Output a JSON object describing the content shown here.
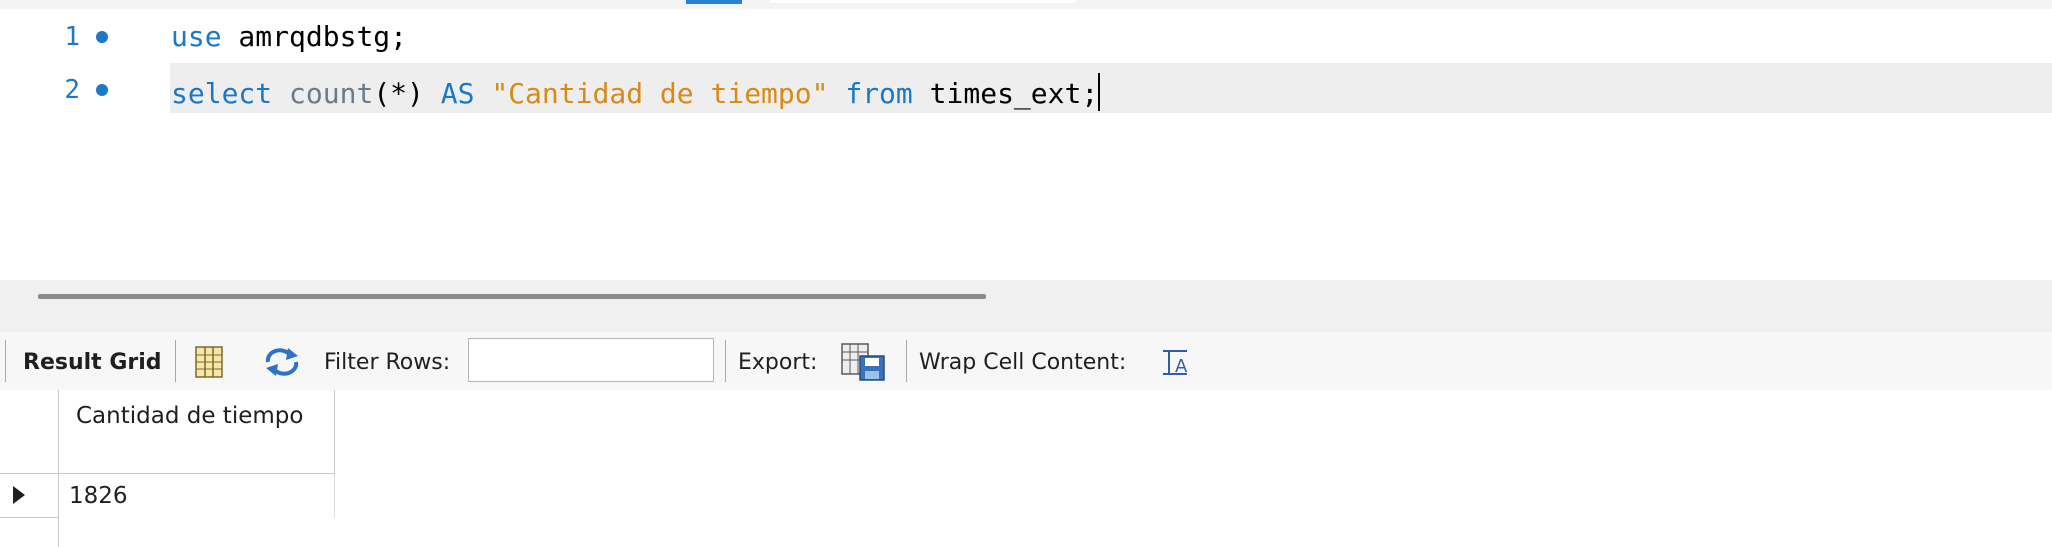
{
  "editor": {
    "lines": [
      {
        "number": "1",
        "tokens": [
          {
            "text": "use",
            "kind": "kw"
          },
          {
            "text": " amrqdbstg;",
            "kind": "plain"
          }
        ]
      },
      {
        "number": "2",
        "tokens": [
          {
            "text": "select",
            "kind": "kw"
          },
          {
            "text": " ",
            "kind": "plain"
          },
          {
            "text": "count",
            "kind": "fn"
          },
          {
            "text": "(*) ",
            "kind": "plain"
          },
          {
            "text": "AS",
            "kind": "kw"
          },
          {
            "text": " ",
            "kind": "plain"
          },
          {
            "text": "\"Cantidad de tiempo\"",
            "kind": "str"
          },
          {
            "text": " ",
            "kind": "plain"
          },
          {
            "text": "from",
            "kind": "kw"
          },
          {
            "text": " times_ext;",
            "kind": "plain"
          }
        ]
      }
    ]
  },
  "result_toolbar": {
    "result_grid_label": "Result Grid",
    "filter_rows_label": "Filter Rows:",
    "filter_value": "",
    "export_label": "Export:",
    "wrap_cell_label": "Wrap Cell Content:",
    "wrap_icon_glyph": "IA"
  },
  "grid": {
    "columns": [
      "Cantidad de tiempo"
    ],
    "rows": [
      [
        "1826"
      ]
    ]
  },
  "colors": {
    "keyword": "#1a78c8",
    "function": "#6c7a8a",
    "string": "#d98a17",
    "gutter": "#1e78c8"
  },
  "icons": {
    "grid_view": "grid-view-icon",
    "refresh": "refresh-icon",
    "export": "export-icon",
    "wrap": "wrap-cell-icon"
  }
}
